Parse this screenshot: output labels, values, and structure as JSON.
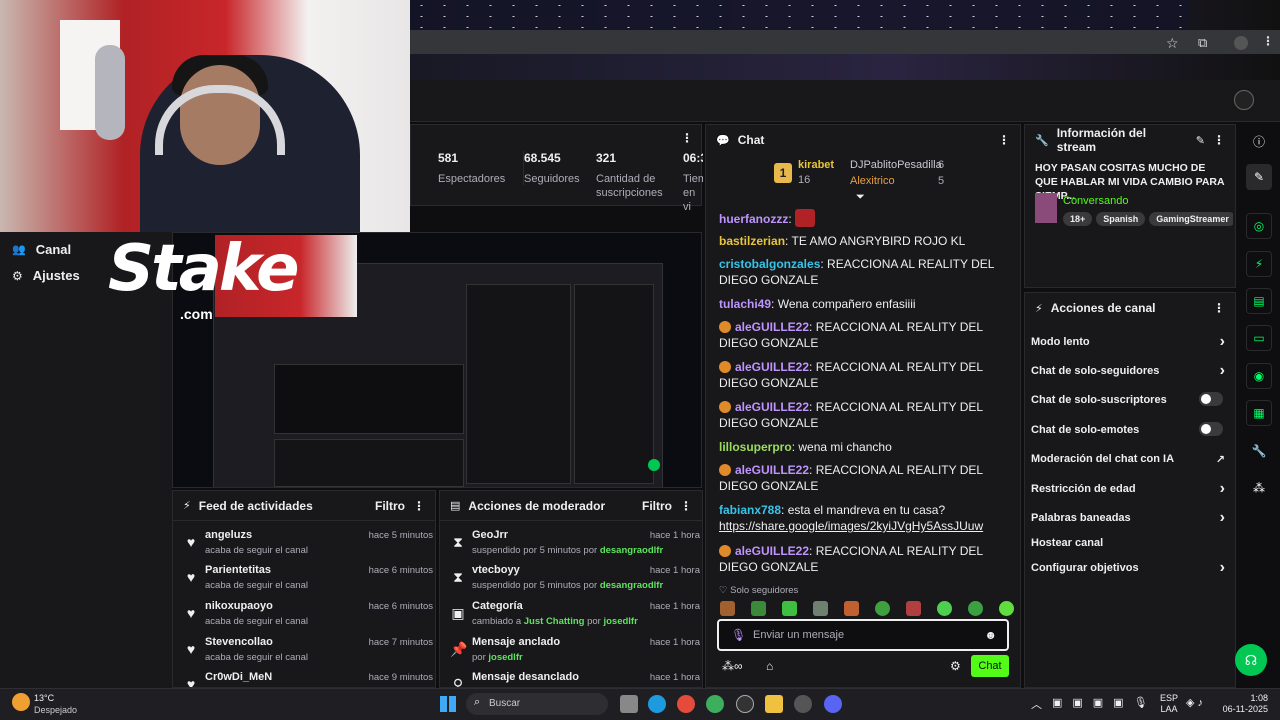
{
  "sidebar": {
    "items": [
      {
        "label": "Canal",
        "icon": "users-icon"
      },
      {
        "label": "Ajustes",
        "icon": "gear-icon"
      }
    ]
  },
  "overlay": {
    "brand": "Stake",
    "brand_sub": ".com"
  },
  "stats": [
    {
      "value": "581",
      "label": "Espectadores"
    },
    {
      "value": "68.545",
      "label": "Seguidores"
    },
    {
      "value": "321",
      "label": "Cantidad de suscripciones"
    },
    {
      "value": "06:3",
      "label": "Tiem en vi"
    }
  ],
  "feed": {
    "title": "Feed de actividades",
    "filter": "Filtro",
    "items": [
      {
        "name": "angeluzs",
        "sub": "acaba de seguir el canal",
        "time": "hace 5 minutos"
      },
      {
        "name": "Parientetitas",
        "sub": "acaba de seguir el canal",
        "time": "hace 6 minutos"
      },
      {
        "name": "nikoxupaoyo",
        "sub": "acaba de seguir el canal",
        "time": "hace 6 minutos"
      },
      {
        "name": "Stevencollao",
        "sub": "acaba de seguir el canal",
        "time": "hace 7 minutos"
      },
      {
        "name": "Cr0wDi_MeN",
        "sub": "",
        "time": "hace 9 minutos"
      }
    ]
  },
  "modactions": {
    "title": "Acciones de moderador",
    "filter": "Filtro",
    "items": [
      {
        "name": "GeoJrr",
        "pre": "suspendido por 5 minutos por",
        "who": "desangraodlfr",
        "time": "hace 1 hora"
      },
      {
        "name": "vtecboyy",
        "pre": "suspendido por 5 minutos por",
        "who": "desangraodlfr",
        "time": "hace 1 hora"
      },
      {
        "name": "Categoría",
        "pre": "cambiado a",
        "who": "Just Chatting",
        "mid": "por",
        "who2": "josedlfr",
        "time": "hace 1 hora"
      },
      {
        "name": "Mensaje anclado",
        "pre": "por",
        "who": "josedlfr",
        "time": "hace 1 hora"
      },
      {
        "name": "Mensaje desanclado",
        "pre": "",
        "who": "",
        "time": "hace 1 hora"
      }
    ]
  },
  "chat": {
    "title": "Chat",
    "leaderboard": {
      "first": {
        "rank": "1",
        "name": "kirabet",
        "count": "16"
      },
      "second": {
        "name": "DJPablitoPesadilla",
        "count": "6"
      },
      "third": {
        "name": "Alexitrico",
        "count": "5"
      }
    },
    "messages": [
      {
        "user": "huerfanozzz",
        "color": "#bf94ff",
        "text": ""
      },
      {
        "user": "bastilzerian",
        "color": "#e8c53b",
        "text": "TE AMO ANGRYBIRD ROJO KL"
      },
      {
        "user": "cristobalgonzales",
        "color": "#37c4e8",
        "text": "REACCIONA AL REALITY DEL DIEGO GONZALE"
      },
      {
        "user": "tulachi49",
        "color": "#bf94ff",
        "text": "Wena compañero enfasiiii"
      },
      {
        "user": "aleGUILLE22",
        "color": "#bf94ff",
        "text": "REACCIONA AL REALITY DEL DIEGO GONZALE"
      },
      {
        "user": "aleGUILLE22",
        "color": "#bf94ff",
        "text": "REACCIONA AL REALITY DEL DIEGO GONZALE"
      },
      {
        "user": "aleGUILLE22",
        "color": "#bf94ff",
        "text": "REACCIONA AL REALITY DEL DIEGO GONZALE"
      },
      {
        "user": "lillosuperpro",
        "color": "#9cdc5c",
        "text": "wena mi chancho"
      },
      {
        "user": "aleGUILLE22",
        "color": "#bf94ff",
        "text": "REACCIONA AL REALITY DEL DIEGO GONZALE"
      },
      {
        "user": "fabianx788",
        "color": "#37c4e8",
        "text": "esta el mandreva en tu casa?",
        "link": "https://share.google/images/2kyiJVgHy5AssJUuw"
      },
      {
        "user": "aleGUILLE22",
        "color": "#bf94ff",
        "text": "REACCIONA AL REALITY DEL DIEGO GONZALE"
      }
    ],
    "mode": "Solo seguidores",
    "placeholder": "Enviar un mensaje",
    "send": "Chat"
  },
  "info": {
    "title": "Información del stream",
    "stream_title": "HOY PASAN COSITAS MUCHO DE QUE HABLAR MI VIDA CAMBIO PARA SIEMP...",
    "category": "Conversando",
    "tags": [
      "18+",
      "Spanish",
      "GamingStreamer"
    ]
  },
  "actions": {
    "title": "Acciones de canal",
    "items": [
      {
        "label": "Modo lento",
        "kind": "chevron"
      },
      {
        "label": "Chat de solo-seguidores",
        "kind": "chevron"
      },
      {
        "label": "Chat de solo-suscriptores",
        "kind": "toggle"
      },
      {
        "label": "Chat de solo-emotes",
        "kind": "toggle"
      },
      {
        "label": "Moderación del chat con IA",
        "kind": "external"
      },
      {
        "label": "Restricción de edad",
        "kind": "chevron"
      },
      {
        "label": "Palabras baneadas",
        "kind": "chevron"
      },
      {
        "label": "Hostear canal",
        "kind": "none"
      },
      {
        "label": "Configurar objetivos",
        "kind": "chevron"
      }
    ]
  },
  "taskbar": {
    "weather_temp": "13°C",
    "weather_desc": "Despejado",
    "search": "Buscar",
    "lang1": "ESP",
    "lang2": "LAA",
    "time": "1:08",
    "date": "06-11-2025"
  }
}
